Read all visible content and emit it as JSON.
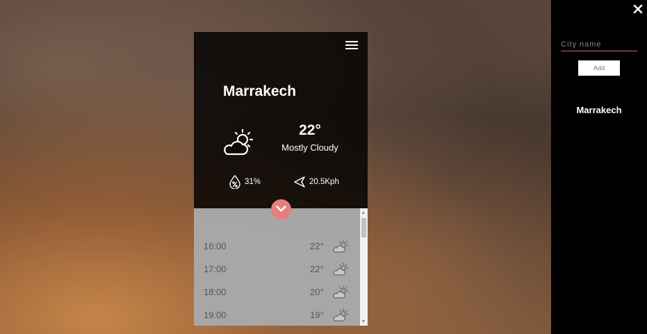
{
  "widget": {
    "city": "Marrakech",
    "temperature": "22°",
    "condition": "Mostly Cloudy",
    "humidity": "31%",
    "wind": "20.5Kph",
    "icons": {
      "menu": "menu-icon",
      "condition": "partly-cloudy-icon",
      "humidity": "humidity-drop-icon",
      "wind": "wind-arrow-icon",
      "toggle": "chevron-down-icon"
    }
  },
  "forecast": [
    {
      "time": "16:00",
      "temp": "22°",
      "icon": "partly-cloudy-icon"
    },
    {
      "time": "17:00",
      "temp": "22°",
      "icon": "partly-cloudy-icon"
    },
    {
      "time": "18:00",
      "temp": "20°",
      "icon": "partly-cloudy-icon"
    },
    {
      "time": "19:00",
      "temp": "19°",
      "icon": "partly-cloudy-icon"
    }
  ],
  "sidebar": {
    "input_placeholder": "City name",
    "add_label": "Add",
    "cities": [
      "Marrakech"
    ],
    "close_icon": "close-icon"
  },
  "colors": {
    "accent": "#e87f7f",
    "input_underline": "#d95f6a",
    "panel_bg": "#000000"
  }
}
